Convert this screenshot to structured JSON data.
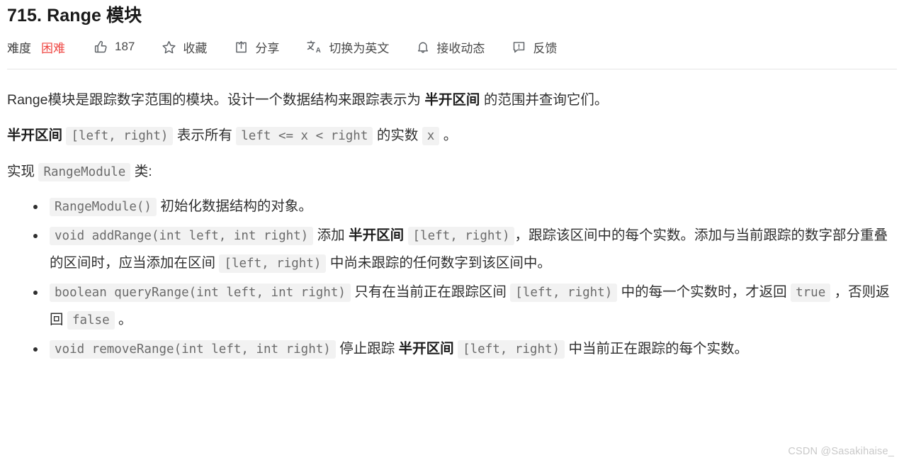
{
  "header": {
    "title": "715. Range 模块",
    "difficulty_label": "难度",
    "difficulty_value": "困难",
    "difficulty_color": "#ef4743",
    "toolbar": [
      {
        "icon": "thumbs-up-icon",
        "label": "187",
        "name": "like-button"
      },
      {
        "icon": "star-icon",
        "label": "收藏",
        "name": "favorite-button"
      },
      {
        "icon": "share-icon",
        "label": "分享",
        "name": "share-button"
      },
      {
        "icon": "translate-icon",
        "label": "切换为英文",
        "name": "translate-button"
      },
      {
        "icon": "bell-icon",
        "label": "接收动态",
        "name": "subscribe-button"
      },
      {
        "icon": "feedback-icon",
        "label": "反馈",
        "name": "feedback-button"
      }
    ]
  },
  "content": {
    "paragraph1": {
      "t1": "Range模块是跟踪数字范围的模块。设计一个数据结构来跟踪表示为 ",
      "b1": "半开区间",
      "t2": " 的范围并查询它们。"
    },
    "paragraph2": {
      "b1": "半开区间",
      "c1": "[left, right)",
      "t1": "表示所有",
      "c2": "left <= x < right",
      "t2": "的实数",
      "c3": "x",
      "t3": "。"
    },
    "paragraph3": {
      "t1": "实现",
      "c1": "RangeModule",
      "t2": "类:"
    },
    "bullets": [
      {
        "name": "bullet-constructor",
        "c1": "RangeModule()",
        "t1": "初始化数据结构的对象。"
      },
      {
        "name": "bullet-add-range",
        "c1": "void addRange(int left, int right)",
        "t1": "添加 ",
        "b1": "半开区间",
        "c2": "[left, right)",
        "t2": "，跟踪该区间中的每个实数。添加与当前跟踪的数字部分重叠的区间时，应当添加在区间",
        "c3": "[left, right)",
        "t3": "中尚未跟踪的任何数字到该区间中。"
      },
      {
        "name": "bullet-query-range",
        "c1": "boolean queryRange(int left, int right)",
        "t1": "只有在当前正在跟踪区间",
        "c2": "[left, right)",
        "t2": "中的每一个实数时，才返回",
        "c3": "true",
        "t3": "，否则返回",
        "c4": "false",
        "t4": "。"
      },
      {
        "name": "bullet-remove-range",
        "c1": "void removeRange(int left, int right)",
        "t1": "停止跟踪 ",
        "b1": "半开区间",
        "c2": "[left, right)",
        "t2": "中当前正在跟踪的每个实数。"
      }
    ]
  },
  "watermark": "CSDN @Sasakihaise_"
}
